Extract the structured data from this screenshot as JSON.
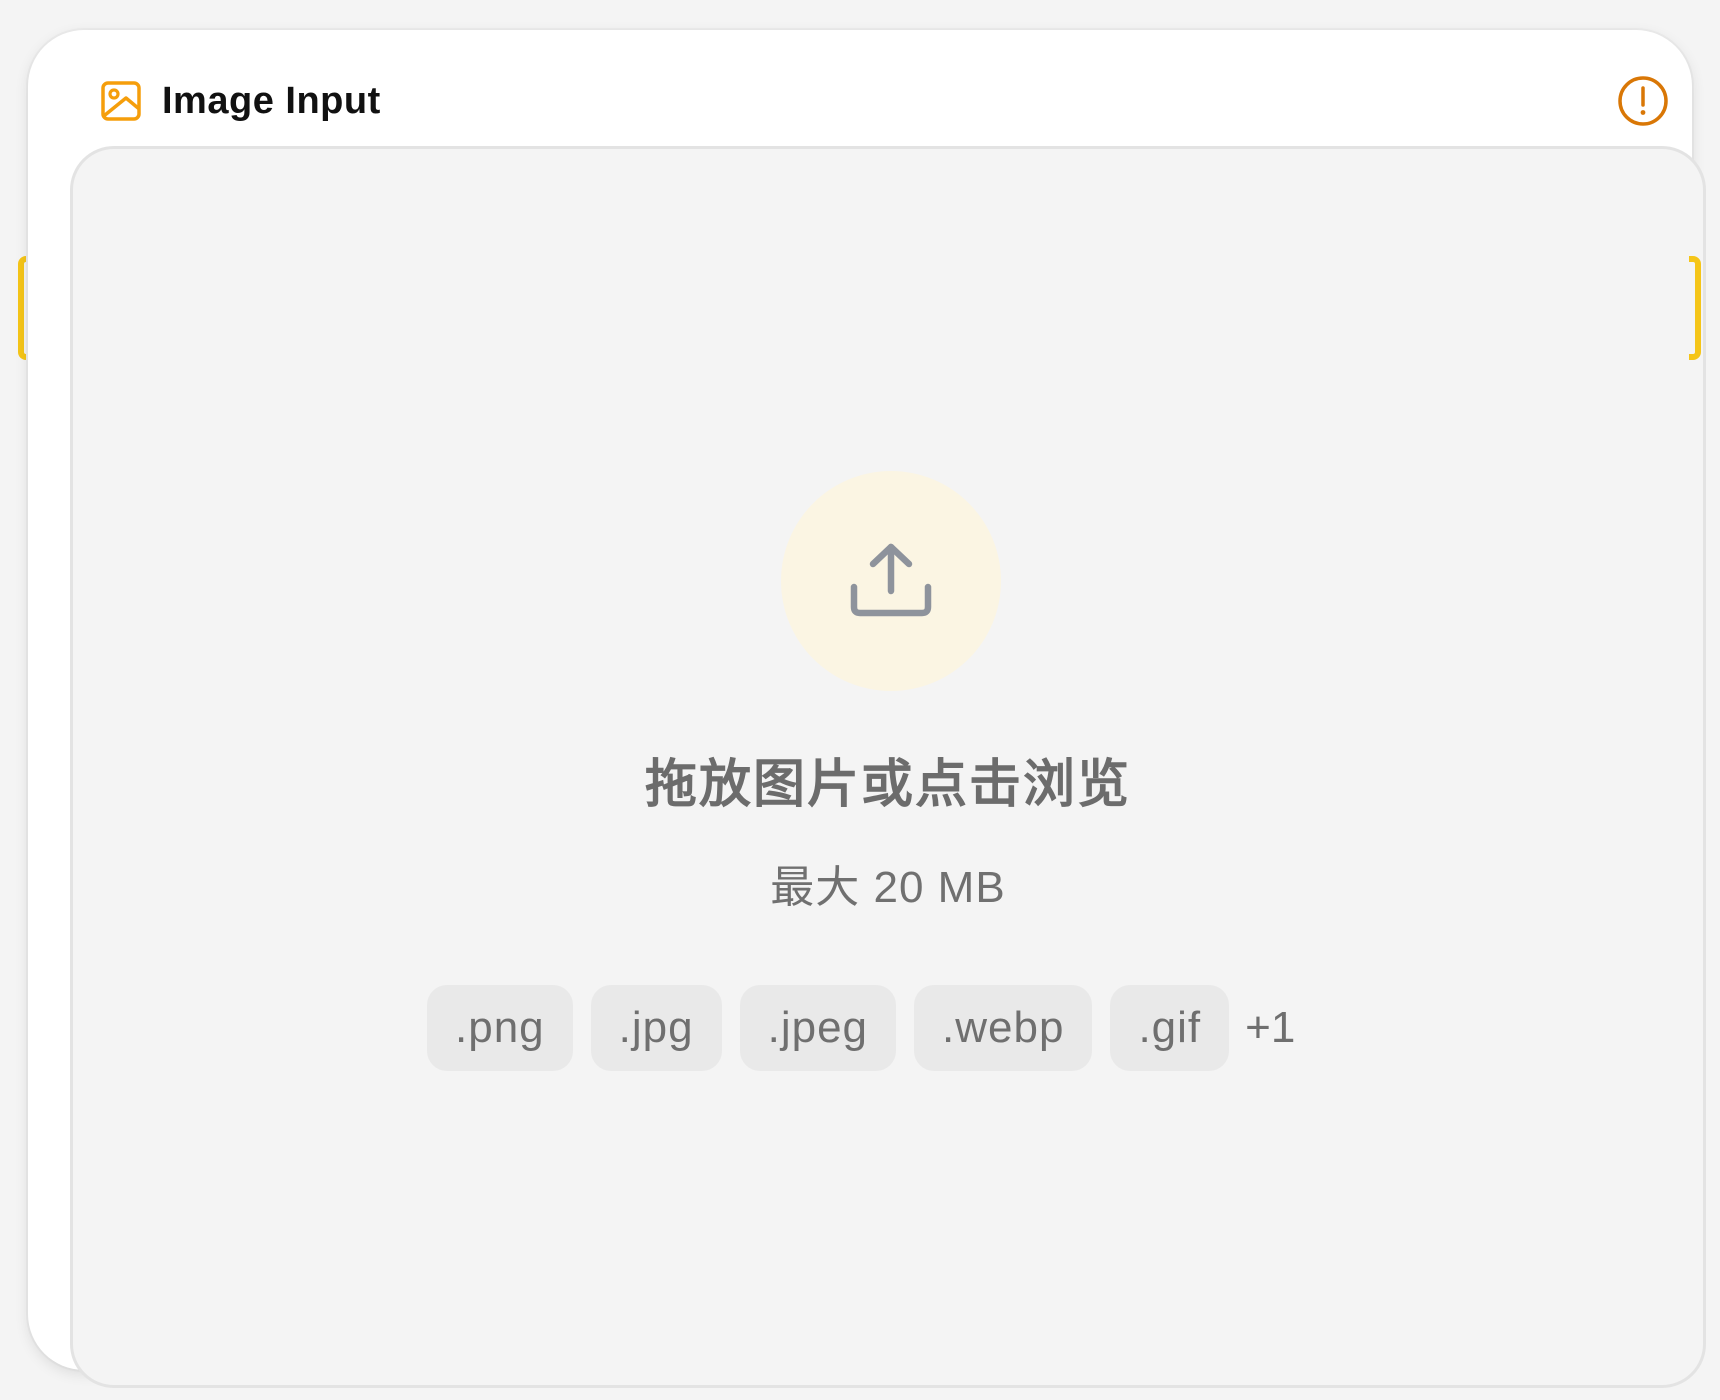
{
  "node": {
    "title": "Image Input",
    "icon": "image-icon",
    "status_icon": "alert-circle-icon",
    "colors": {
      "accent": "#f59e0b",
      "handle": "#f5c518",
      "status": "#d97706",
      "upload_bg": "#fbf5e3"
    }
  },
  "dropzone": {
    "icon": "upload-icon",
    "title": "拖放图片或点击浏览",
    "subtitle": "最大 20 MB",
    "file_types": [
      ".png",
      ".jpg",
      ".jpeg",
      ".webp",
      ".gif"
    ],
    "more_types": "+1"
  }
}
